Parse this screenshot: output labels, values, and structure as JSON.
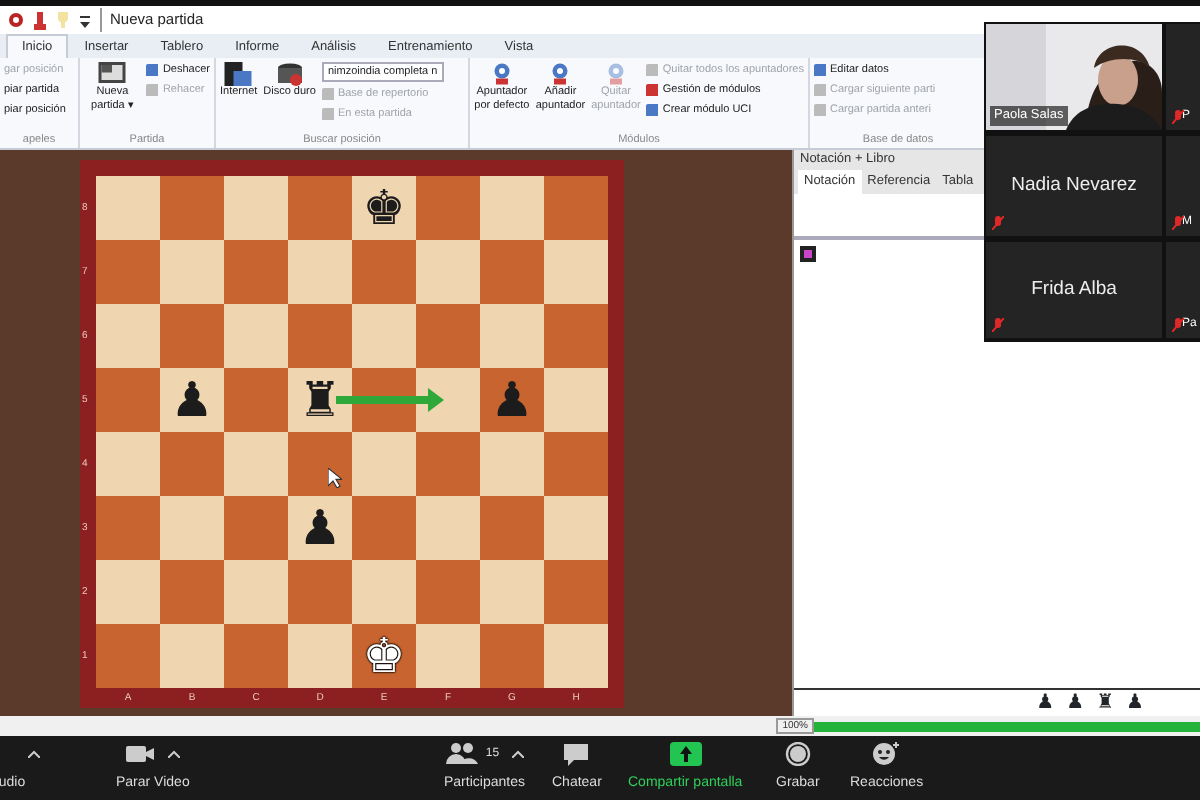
{
  "window": {
    "title": "Nueva partida"
  },
  "tabs": [
    {
      "label": "Inicio",
      "selected": true
    },
    {
      "label": "Insertar",
      "selected": false
    },
    {
      "label": "Tablero",
      "selected": false
    },
    {
      "label": "Informe",
      "selected": false
    },
    {
      "label": "Análisis",
      "selected": false
    },
    {
      "label": "Entrenamiento",
      "selected": false
    },
    {
      "label": "Vista",
      "selected": false
    }
  ],
  "ribbon": {
    "groups": [
      {
        "name": "apeles",
        "small": [
          {
            "label": "gar posición",
            "disabled": true
          },
          {
            "label": "piar partida",
            "disabled": false
          },
          {
            "label": "piar posición",
            "disabled": false
          }
        ]
      },
      {
        "name": "Partida",
        "large": [
          {
            "label": "Nueva partida ▾",
            "disabled": false
          }
        ],
        "small": [
          {
            "label": "Deshacer",
            "disabled": false
          },
          {
            "label": "Rehacer",
            "disabled": true
          }
        ]
      },
      {
        "name": "Buscar posición",
        "large": [
          {
            "label": "Internet",
            "disabled": false
          },
          {
            "label": "Disco duro",
            "disabled": false
          }
        ],
        "dropdown": "nimzoindia completa n",
        "small": [
          {
            "label": "Base de repertorio",
            "disabled": true
          },
          {
            "label": "En esta partida",
            "disabled": true
          }
        ]
      },
      {
        "name": "Módulos",
        "large": [
          {
            "label": "Apuntador por defecto",
            "disabled": false
          },
          {
            "label": "Añadir apuntador",
            "disabled": false
          },
          {
            "label": "Quitar apuntador",
            "disabled": true
          }
        ],
        "small": [
          {
            "label": "Quitar todos los apuntadores",
            "disabled": true
          },
          {
            "label": "Gestión de módulos",
            "disabled": false
          },
          {
            "label": "Crear módulo UCI",
            "disabled": false
          }
        ]
      },
      {
        "name": "Base de datos",
        "small": [
          {
            "label": "Editar datos",
            "disabled": false
          },
          {
            "label": "Cargar siguiente parti",
            "disabled": true
          },
          {
            "label": "Cargar partida anteri",
            "disabled": true
          }
        ]
      }
    ]
  },
  "board": {
    "ranks": [
      "8",
      "7",
      "6",
      "5",
      "4",
      "3",
      "2",
      "1"
    ],
    "files": [
      "A",
      "B",
      "C",
      "D",
      "E",
      "F",
      "G",
      "H"
    ],
    "rows": [
      [
        null,
        null,
        null,
        null,
        {
          "glyph": "♚",
          "white": false
        },
        null,
        null,
        null
      ],
      [
        null,
        null,
        null,
        null,
        null,
        null,
        null,
        null
      ],
      [
        null,
        null,
        null,
        null,
        null,
        null,
        null,
        null
      ],
      [
        null,
        {
          "glyph": "♟",
          "white": false
        },
        null,
        {
          "glyph": "♜",
          "white": false,
          "arrow_start": true
        },
        null,
        {
          "arrow_end": true
        },
        {
          "glyph": "♟",
          "white": false
        },
        null
      ],
      [
        null,
        null,
        null,
        null,
        null,
        null,
        null,
        null
      ],
      [
        null,
        null,
        null,
        {
          "glyph": "♟",
          "white": false
        },
        null,
        null,
        null,
        null
      ],
      [
        null,
        null,
        null,
        null,
        null,
        null,
        null,
        null
      ],
      [
        null,
        null,
        null,
        null,
        {
          "glyph": "♚",
          "white": true
        },
        null,
        null,
        null
      ]
    ]
  },
  "notation_panel": {
    "title": "Notación + Libro",
    "tabs": [
      {
        "label": "Notación",
        "selected": true
      },
      {
        "label": "Referencia",
        "selected": false
      },
      {
        "label": "Tabla",
        "selected": false
      }
    ],
    "material": [
      "♟",
      "♟",
      "♜",
      "♟"
    ]
  },
  "status_bar": {
    "zoom": "100%",
    "level": 1
  },
  "meeting": {
    "tiles": [
      {
        "kind": "video",
        "name": "Paola Salas",
        "speaking": true,
        "muted": false
      },
      {
        "kind": "partial",
        "name": "P",
        "speaking": false,
        "muted": true
      },
      {
        "kind": "name",
        "name": "Nadia Nevarez",
        "speaking": false,
        "muted": true
      },
      {
        "kind": "partial",
        "name": "M",
        "speaking": false,
        "muted": true
      },
      {
        "kind": "name",
        "name": "Frida Alba",
        "speaking": false,
        "muted": true
      },
      {
        "kind": "partial",
        "name": "Pa",
        "speaking": false,
        "muted": true
      }
    ],
    "toolbar": [
      {
        "kind": "audio",
        "label": "udio",
        "caret": true
      },
      {
        "kind": "video",
        "label": "Parar Video",
        "caret": true
      },
      {
        "kind": "participants",
        "label": "Participantes",
        "count": "15",
        "caret": true
      },
      {
        "kind": "chat",
        "label": "Chatear",
        "caret": false
      },
      {
        "kind": "share",
        "label": "Compartir pantalla",
        "caret": false
      },
      {
        "kind": "record",
        "label": "Grabar",
        "caret": false
      },
      {
        "kind": "reactions",
        "label": "Reacciones",
        "caret": false
      }
    ]
  }
}
